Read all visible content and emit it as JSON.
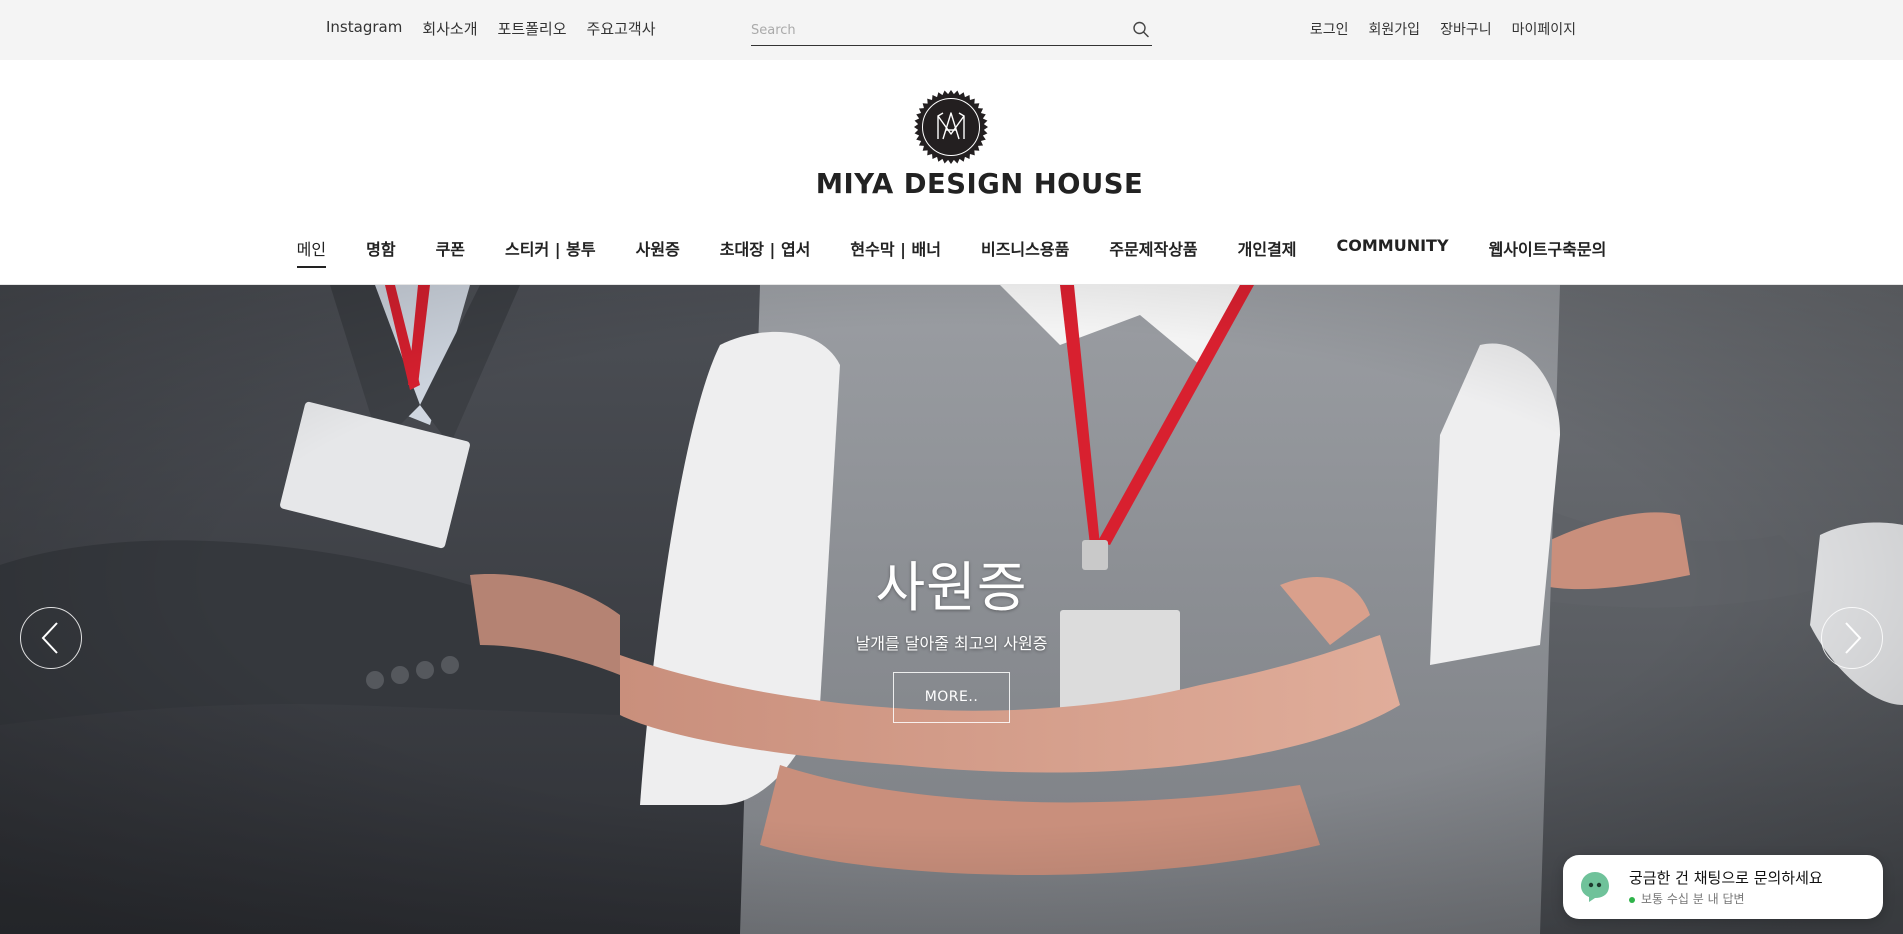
{
  "top_links": [
    "Instagram",
    "회사소개",
    "포트폴리오",
    "주요고객사"
  ],
  "search": {
    "placeholder": "Search",
    "value": ""
  },
  "user_links": [
    "로그인",
    "회원가입",
    "장바구니",
    "마이페이지"
  ],
  "logo": {
    "text": "MIYA DESIGN HOUSE"
  },
  "nav": {
    "active_index": 0,
    "items": [
      "메인",
      "명함",
      "쿠폰",
      "스티커 | 봉투",
      "사원증",
      "초대장 | 엽서",
      "현수막 | 배너",
      "비즈니스용품",
      "주문제작상품",
      "개인결제",
      "COMMUNITY",
      "웹사이트구축문의"
    ]
  },
  "hero": {
    "title": "사원증",
    "subtitle": "날개를 달아줄 최고의 사원증",
    "button": "MORE.."
  },
  "chat": {
    "title": "궁금한 건 채팅으로 문의하세요",
    "status": "보통 수십 분 내 답변"
  },
  "colors": {
    "topbar_bg": "#f4f4f4",
    "text": "#222222",
    "lanyard_red": "#d8202f",
    "status_green": "#2fb34a"
  }
}
